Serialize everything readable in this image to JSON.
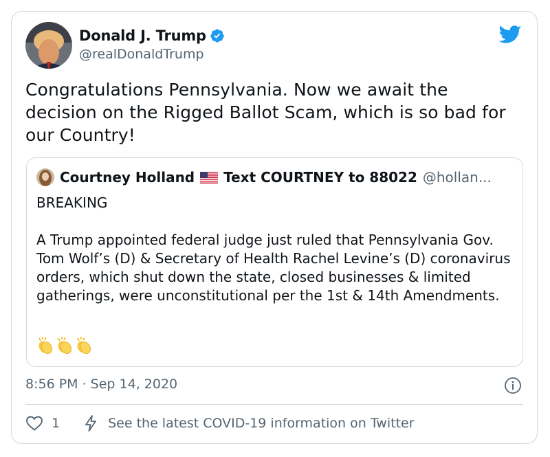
{
  "author": {
    "name": "Donald J. Trump",
    "handle": "@realDonaldTrump",
    "verified_icon": "verified-badge-icon"
  },
  "brand": {
    "icon": "twitter-bird-icon",
    "color": "#1d9bf0"
  },
  "tweet": {
    "text": "Congratulations Pennsylvania. Now we await the decision on the Rigged Ballot Scam, which is so bad for our Country!",
    "timestamp": "8:56 PM · Sep 14, 2020"
  },
  "quoted_tweet": {
    "name": "Courtney Holland",
    "flag_icon": "us-flag-icon",
    "name_suffix": "Text COURTNEY to 88022",
    "handle": "@hollan...",
    "body": "BREAKING\n\nA Trump appointed federal judge just ruled that Pennsylvania Gov. Tom Wolf’s (D) & Secretary of Health Rachel Levine’s (D) coronavirus orders, which shut down the state, closed businesses & limited gatherings, were unconstitutional per the 1st & 14th Amendments.",
    "emoji_icons": [
      "clapping-hands-icon",
      "clapping-hands-icon",
      "clapping-hands-icon"
    ]
  },
  "actions": {
    "like_count": "1",
    "covid_link": "See the latest COVID-19 information on Twitter"
  },
  "colors": {
    "text": "#0f1419",
    "secondary": "#536471",
    "border": "#cfd9de",
    "verified": "#1d9bf0"
  }
}
